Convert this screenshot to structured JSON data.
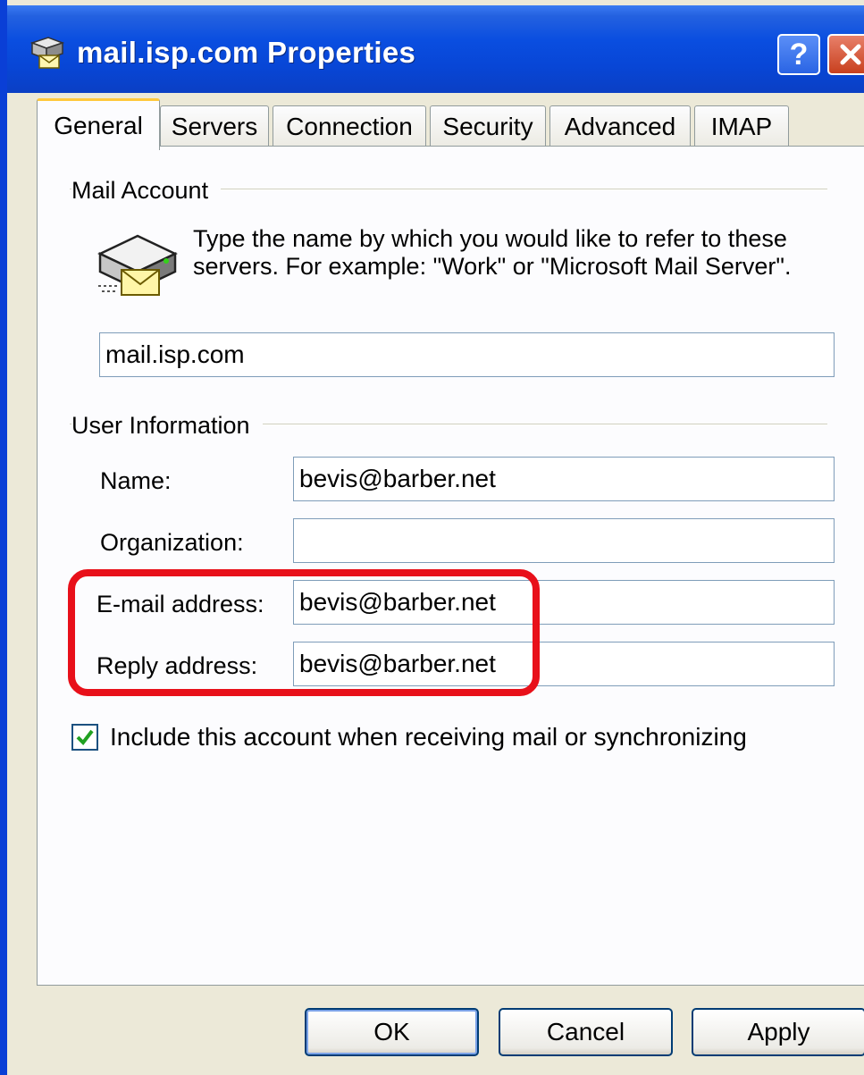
{
  "window": {
    "title": "mail.isp.com Properties",
    "help_label": "?",
    "close_label": "close",
    "accent_color": "#0a4ee0",
    "highlight_color": "#e8101a"
  },
  "tabs": [
    {
      "label": "General",
      "active": true
    },
    {
      "label": "Servers",
      "active": false
    },
    {
      "label": "Connection",
      "active": false
    },
    {
      "label": "Security",
      "active": false
    },
    {
      "label": "Advanced",
      "active": false
    },
    {
      "label": "IMAP",
      "active": false
    }
  ],
  "mail_account": {
    "group_label": "Mail Account",
    "description": "Type the name by which you would like to refer to these servers.  For example: \"Work\" or \"Microsoft Mail Server\".",
    "account_name_value": "mail.isp.com",
    "icon": "mail-server-icon"
  },
  "user_information": {
    "group_label": "User Information",
    "name_label": "Name:",
    "name_value": "bevis@barber.net",
    "organization_label": "Organization:",
    "organization_value": "",
    "email_label": "E-mail address:",
    "email_value": "bevis@barber.net",
    "reply_label": "Reply address:",
    "reply_value": "bevis@barber.net"
  },
  "include_account": {
    "label": "Include this account when receiving mail or synchronizing",
    "checked": true
  },
  "buttons": {
    "ok": "OK",
    "cancel": "Cancel",
    "apply": "Apply"
  }
}
